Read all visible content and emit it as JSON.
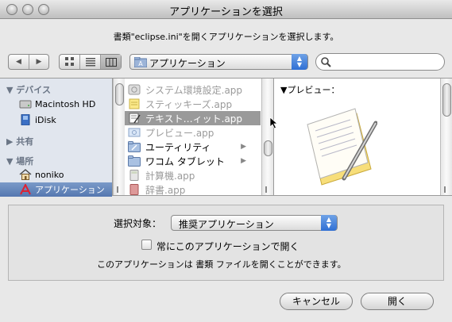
{
  "window": {
    "title": "アプリケーションを選択"
  },
  "prompt": "書類\"eclipse.ini\"を開くアプリケーションを選択します。",
  "toolbar": {
    "back_glyph": "◀",
    "forward_glyph": "▶",
    "view_icons": [
      "icon-view-icon",
      "list-view-icon",
      "column-view-icon"
    ],
    "location": "アプリケーション",
    "search_placeholder": ""
  },
  "sidebar": {
    "sections": [
      {
        "title": "▼ デバイス",
        "items": [
          "Macintosh HD",
          "iDisk"
        ]
      },
      {
        "title": "▶ 共有",
        "items": []
      },
      {
        "title": "▼ 場所",
        "items": [
          "noniko",
          "アプリケーション"
        ]
      }
    ],
    "selected": "アプリケーション"
  },
  "files": [
    {
      "name": "システム環境設定.app",
      "icon": "system-prefs-icon",
      "state": "dim"
    },
    {
      "name": "スティッキーズ.app",
      "icon": "stickies-icon",
      "state": "dim"
    },
    {
      "name": "テキスト…ィット.app",
      "icon": "textedit-icon",
      "state": "selected"
    },
    {
      "name": "プレビュー.app",
      "icon": "preview-icon",
      "state": "dim"
    },
    {
      "name": "ユーティリティ",
      "icon": "folder-icon",
      "state": "folder"
    },
    {
      "name": "ワコム タブレット",
      "icon": "folder-icon",
      "state": "folder"
    },
    {
      "name": "計算機.app",
      "icon": "calculator-icon",
      "state": "dim"
    },
    {
      "name": "辞書.app",
      "icon": "dictionary-icon",
      "state": "dim"
    }
  ],
  "preview": {
    "label": "▼プレビュー："
  },
  "bottom": {
    "enable_label": "選択対象：",
    "enable_value": "推奨アプリケーション",
    "always_open_label": "常にこのアプリケーションで開く",
    "info": "このアプリケーションは 書類 ファイルを開くことができます。"
  },
  "buttons": {
    "cancel": "キャンセル",
    "open": "開く"
  }
}
